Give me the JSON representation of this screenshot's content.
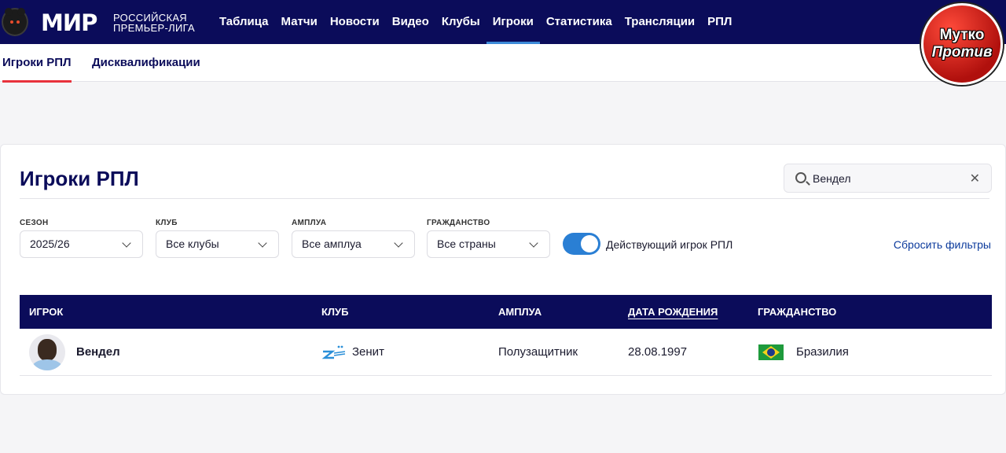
{
  "header": {
    "logo_text": "МИР",
    "logo_sub_line1": "РОССИЙСКАЯ",
    "logo_sub_line2": "ПРЕМЬЕР-ЛИГА",
    "nav": [
      {
        "label": "Таблица",
        "active": false
      },
      {
        "label": "Матчи",
        "active": false
      },
      {
        "label": "Новости",
        "active": false
      },
      {
        "label": "Видео",
        "active": false
      },
      {
        "label": "Клубы",
        "active": false
      },
      {
        "label": "Игроки",
        "active": true
      },
      {
        "label": "Статистика",
        "active": false
      },
      {
        "label": "Трансляции",
        "active": false
      },
      {
        "label": "РПЛ",
        "active": false
      }
    ]
  },
  "badge": {
    "line1": "Мутко",
    "line2": "Против"
  },
  "subnav": {
    "tabs": [
      {
        "label": "Игроки РПЛ",
        "active": true
      },
      {
        "label": "Дисквалификации",
        "active": false
      }
    ]
  },
  "main": {
    "title": "Игроки РПЛ",
    "search": {
      "value": "Вендел",
      "icon": "search-icon"
    },
    "filters": {
      "season": {
        "label": "СЕЗОН",
        "value": "2025/26"
      },
      "club": {
        "label": "КЛУБ",
        "value": "Все клубы"
      },
      "position": {
        "label": "АМПЛУА",
        "value": "Все амплуа"
      },
      "citizenship": {
        "label": "ГРАЖДАНСТВО",
        "value": "Все страны"
      }
    },
    "active_toggle": {
      "label": "Действующий игрок РПЛ",
      "on": true
    },
    "reset_label": "Сбросить фильтры",
    "table": {
      "columns": [
        "ИГРОК",
        "КЛУБ",
        "АМПЛУА",
        "ДАТА РОЖДЕНИЯ",
        "ГРАЖДАНСТВО"
      ],
      "sorted_column": "ДАТА РОЖДЕНИЯ",
      "rows": [
        {
          "player": "Вендел",
          "club": "Зенит",
          "position": "Полузащитник",
          "birth_date": "28.08.1997",
          "citizenship": "Бразилия"
        }
      ]
    }
  },
  "colors": {
    "nav_bg": "#0b0c5a",
    "accent_red": "#e8323c",
    "toggle_blue": "#2a7fd4",
    "link_blue": "#0b3a9c"
  }
}
